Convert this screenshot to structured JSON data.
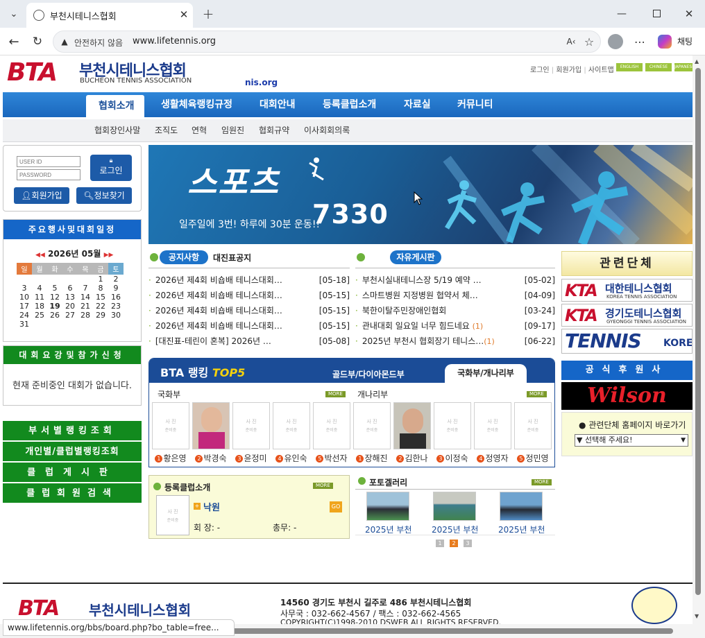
{
  "browser": {
    "tab_title": "부천시테니스협회",
    "security_label": "안전하지 않음",
    "url": "www.lifetennis.org",
    "copilot_label": "채팅",
    "status_url": "www.lifetennis.org/bbs/board.php?bo_table=free..."
  },
  "header": {
    "logo_letters": "BTA",
    "logo_kr": "부천시테니스협회",
    "logo_en": "BUCHEON TENNIS ASSOCIATION",
    "domain_fragment": "nis.org",
    "top_links": [
      "로그인",
      "회원가입",
      "사이트맵"
    ],
    "lang_buttons": [
      "ENGLISH",
      "CHINESE",
      "JAPANESE"
    ]
  },
  "nav": {
    "items": [
      "협회소개",
      "생활체육랭킹규정",
      "대회안내",
      "등록클럽소개",
      "자료실",
      "커뮤니티"
    ],
    "sub_items": [
      "협회장인사말",
      "조직도",
      "연혁",
      "임원진",
      "협회규약",
      "이사회회의록"
    ]
  },
  "login": {
    "id_placeholder": "USER ID",
    "pw_placeholder": "PASSWORD",
    "login_label": "로그인",
    "join_label": "회원가입",
    "find_label": "정보찾기"
  },
  "calendar": {
    "header": "주요행사및대회일정",
    "month": "2026년 05월",
    "weekdays": [
      "일",
      "월",
      "화",
      "수",
      "목",
      "금",
      "토"
    ],
    "weeks": [
      [
        "",
        "",
        "",
        "",
        "",
        "1",
        "2"
      ],
      [
        "3",
        "4",
        "5",
        "6",
        "7",
        "8",
        "9"
      ],
      [
        "10",
        "11",
        "12",
        "13",
        "14",
        "15",
        "16"
      ],
      [
        "17",
        "18",
        "19",
        "20",
        "21",
        "22",
        "23"
      ],
      [
        "24",
        "25",
        "26",
        "27",
        "28",
        "29",
        "30"
      ],
      [
        "31",
        "",
        "",
        "",
        "",
        "",
        ""
      ]
    ]
  },
  "apply": {
    "header": "대회요강및참가신청",
    "message": "현재 준비중인 대회가 없습니다."
  },
  "side_menu": [
    "부서별랭킹조회",
    "개인별/클럽별랭킹조회",
    "클럽게시판",
    "클럽회원검색"
  ],
  "banner": {
    "title": "스포츠",
    "number": "7330",
    "slogan": "일주일에 3번! 하루에 30분 운동!!"
  },
  "notice": {
    "tab_label": "공지사항",
    "tab2_label": "대진표공지",
    "items": [
      {
        "title": "2026년 제4회 비숍배 테니스대회…",
        "date": "[05-18]"
      },
      {
        "title": "2026년 제4회 비숍배 테니스대회…",
        "date": "[05-15]"
      },
      {
        "title": "2026년 제4회 비숍배 테니스대회…",
        "date": "[05-15]"
      },
      {
        "title": "2026년 제4회 비숍배 테니스대회…",
        "date": "[05-15]"
      },
      {
        "title": "[대진표-테린이 혼복] 2026년 …",
        "date": "[05-08]"
      }
    ]
  },
  "free": {
    "tab_label": "자유게시판",
    "items": [
      {
        "title": "부천시실내테니스장 5/19 예약 …",
        "count": "",
        "date": "[05-02]"
      },
      {
        "title": "스마트병원 지정병원 협약서 체…",
        "count": "",
        "date": "[04-09]"
      },
      {
        "title": "북한이탈주민장애인협회",
        "count": "",
        "date": "[03-24]"
      },
      {
        "title": "관내대회 일요일 너무 힘드네요",
        "count": "(1)",
        "date": "[09-17]"
      },
      {
        "title": "2025년 부천시 협회장기 테니스…",
        "count": "(1)",
        "date": "[06-22]"
      }
    ]
  },
  "ranking": {
    "title_prefix": "BTA 랭킹",
    "title_suffix": "TOP5",
    "tab1": "골드부/다이아몬드부",
    "tab2": "국화부/개나리부",
    "group1": "국화부",
    "group2": "개나리부",
    "more": "MORE",
    "photo_placeholder": [
      "사 진",
      "준비중"
    ],
    "players1": [
      {
        "rank": "1",
        "name": "황은영"
      },
      {
        "rank": "2",
        "name": "박경숙"
      },
      {
        "rank": "3",
        "name": "윤정미"
      },
      {
        "rank": "4",
        "name": "유인숙"
      },
      {
        "rank": "5",
        "name": "박선자"
      }
    ],
    "players2": [
      {
        "rank": "1",
        "name": "장해진"
      },
      {
        "rank": "2",
        "name": "김한나"
      },
      {
        "rank": "3",
        "name": "이정숙"
      },
      {
        "rank": "4",
        "name": "정영자"
      },
      {
        "rank": "5",
        "name": "정민영"
      }
    ]
  },
  "club": {
    "title": "등록클럽소개",
    "name": "낙원",
    "go": "GO",
    "president_label": "회 장: -",
    "secretary_label": "총무: -",
    "photo_placeholder": [
      "사 진",
      "준비중"
    ]
  },
  "gallery": {
    "title": "포토겔러리",
    "items": [
      "2025년 부천",
      "2025년 부천",
      "2025년 부천"
    ],
    "pages": [
      "1",
      "2",
      "3"
    ]
  },
  "related": {
    "header": "관련단체",
    "logos": [
      {
        "mark": "KTA",
        "kr": "대한테니스협회",
        "en": "KOREA TENNIS ASSOCIATION"
      },
      {
        "mark": "KTA",
        "kr": "경기도테니스협회",
        "en": "GYEONGGI TENNIS ASSOCIATION"
      },
      {
        "mark": "TENNIS",
        "kr": "",
        "en": "KOREA"
      }
    ],
    "sponsor_header": "공식후원사",
    "sponsor": "Wilson",
    "link_label": "관련단체 홈페이지 바로가기",
    "select_value": "▼ 선택해 주세요!"
  },
  "footer": {
    "address": "14560 경기도 부천시 길주로 486 부천시테니스협회",
    "contact": "사무국 : 032-662-4567 / 팩스 : 032-662-4565",
    "copyright": "COPYRIGHT(C)1998-2010 DSWEB ALL RIGHTS RESERVED."
  },
  "colors": {
    "nav_blue": "#1a67bd",
    "green": "#128a1e",
    "accent_red": "#c8102e",
    "navy": "#1b3b8b"
  }
}
